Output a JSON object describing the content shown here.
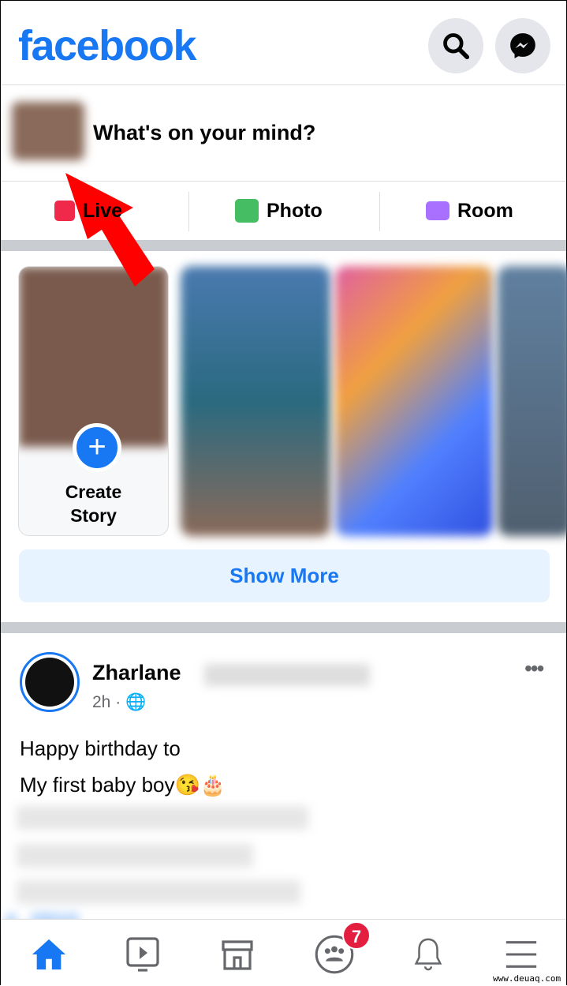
{
  "header": {
    "logo": "facebook",
    "search_icon": "search-icon",
    "messenger_icon": "messenger-icon"
  },
  "composer": {
    "placeholder": "What's on your mind?"
  },
  "actions": [
    {
      "label": "Live",
      "icon": "live-video-icon",
      "color": "#f02849"
    },
    {
      "label": "Photo",
      "icon": "photo-icon",
      "color": "#45bd62"
    },
    {
      "label": "Room",
      "icon": "room-icon",
      "color": "#a970ff"
    }
  ],
  "stories": {
    "create_line1": "Create",
    "create_line2": "Story",
    "show_more": "Show More"
  },
  "post": {
    "author": "Zharlane",
    "time": "2h",
    "privacy_icon": "globe-icon",
    "line1": "Happy birthday to",
    "line2": "My first baby boy😘🎂",
    "hashtag": "#...l2010"
  },
  "nav": {
    "items": [
      "home",
      "watch",
      "marketplace",
      "groups",
      "notifications",
      "menu"
    ],
    "groups_badge": "7"
  },
  "watermark": "www.deuaq.com",
  "colors": {
    "brand": "#1877f2",
    "badge": "#e41e3f",
    "annotation_arrow": "#ff0000"
  }
}
